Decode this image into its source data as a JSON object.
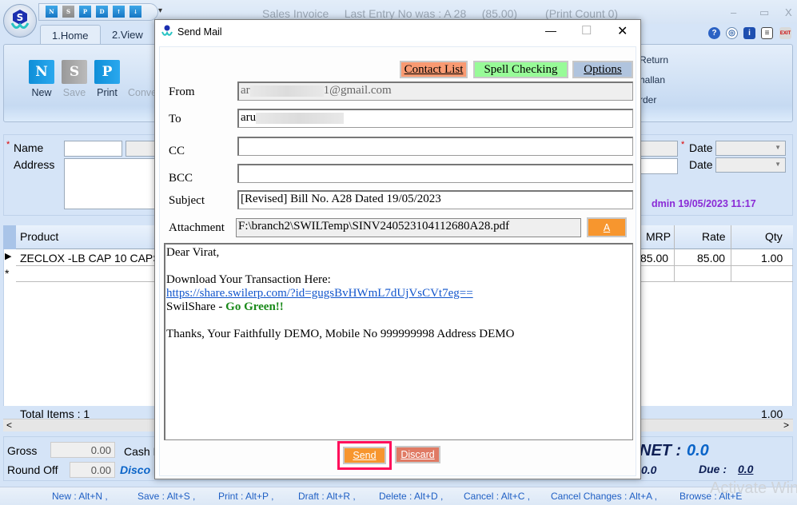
{
  "window": {
    "title": "Sales Invoice     Last Entry No was : A 28     (85.00)         (Print Count 0)",
    "controls": [
      "–",
      "▭",
      "X"
    ]
  },
  "quick_access": {
    "buttons": [
      {
        "label": "N",
        "state": "enabled"
      },
      {
        "label": "S",
        "state": "disabled"
      },
      {
        "label": "P",
        "state": "enabled"
      },
      {
        "label": "D",
        "state": "enabled"
      },
      {
        "label": "↑",
        "state": "enabled"
      },
      {
        "label": "↓",
        "state": "enabled"
      }
    ],
    "more": "▾"
  },
  "ribbon": {
    "tabs": [
      {
        "label": "1.Home"
      },
      {
        "label": "2.View"
      }
    ],
    "buttons": [
      {
        "label": "New",
        "glyph": "N"
      },
      {
        "label": "Save",
        "glyph": "S"
      },
      {
        "label": "Print",
        "glyph": "P"
      },
      {
        "label": "Conve"
      }
    ],
    "right_list": [
      "Return",
      "hallan",
      "rder"
    ],
    "header_icons": [
      "help-icon",
      "monitor-icon",
      "info-icon",
      "document-icon",
      "exit-icon"
    ],
    "header_glyphs": {
      "help": "?",
      "monitor": "◎",
      "info": "i",
      "doc": "≡",
      "exit": "EXIT"
    }
  },
  "form": {
    "name_label": "Name",
    "address_label": "Address",
    "required_mark": "*",
    "date_label_1": "Date",
    "date_label_2": "Date",
    "audit_line": "dmin 19/05/2023 11:17"
  },
  "grid": {
    "columns": [
      "Product",
      "MRP",
      "Rate",
      "Qty"
    ],
    "rows": [
      {
        "product": "ZECLOX -LB CAP 10 CAPS",
        "mrp": "85.00",
        "rate": "85.00",
        "qty": "1.00"
      }
    ],
    "new_row_marker": "*",
    "current_row_marker": "▶",
    "total_items": "Total Items : 1",
    "total_qty": "1.00",
    "scroll_left": "<",
    "scroll_right": ">"
  },
  "totals": {
    "gross_label": "Gross",
    "gross_value": "0.00",
    "round_off_label": "Round Off",
    "round_off_value": "0.00",
    "cash_label": "Cash D",
    "discount_label": "Disco",
    "net_label": "NET :",
    "net_value": "0.0",
    "left_value": "0.0",
    "due_label": "Due :",
    "due_value": "0.0"
  },
  "shortcuts": [
    "New : Alt+N ,",
    "Save : Alt+S ,",
    "Print : Alt+P ,",
    "Draft : Alt+R ,",
    "Delete : Alt+D ,",
    "Cancel : Alt+C ,",
    "Cancel Changes : Alt+A ,",
    "Browse : Alt+E"
  ],
  "watermark": "Activate Win",
  "dialog": {
    "title": "Send Mail",
    "controls": {
      "minimize": "—",
      "maximize": "☐",
      "close": "✕"
    },
    "toolbar": {
      "contact_list": "Contact List",
      "spell_checking": "Spell Checking",
      "options": "Options"
    },
    "colors": {
      "contact_list": "#f99a72",
      "spell_checking": "#98fb98",
      "options": "#b0c4de",
      "send": "#f7962e",
      "discard": "#e07a64",
      "highlight": "#ff0a5a"
    },
    "fields": {
      "from_label": "From",
      "from_prefix": "ar",
      "from_suffix": "1@gmail.com",
      "to_label": "To",
      "to_prefix": "aru",
      "cc_label": "CC",
      "cc_value": "",
      "bcc_label": "BCC",
      "bcc_value": "",
      "subject_label": "Subject",
      "subject_value": "[Revised] Bill No. A28 Dated 19/05/2023",
      "attachment_label": "Attachment",
      "attachment_value": "F:\\branch2\\SWILTemp\\SINV240523104112680A28.pdf",
      "attach_button": "A"
    },
    "body": {
      "greeting": "Dear Virat,",
      "download_line": "Download Your Transaction Here:",
      "link": "https://share.swilerp.com/?id=gugsBvHWmL7dUjVsCVt7eg==",
      "share_prefix": "SwilShare - ",
      "share_green": "Go Green!!",
      "signature": "Thanks, Your Faithfully DEMO, Mobile No 999999998 Address DEMO"
    },
    "buttons": {
      "send": "Send",
      "discard": "Discard"
    }
  }
}
